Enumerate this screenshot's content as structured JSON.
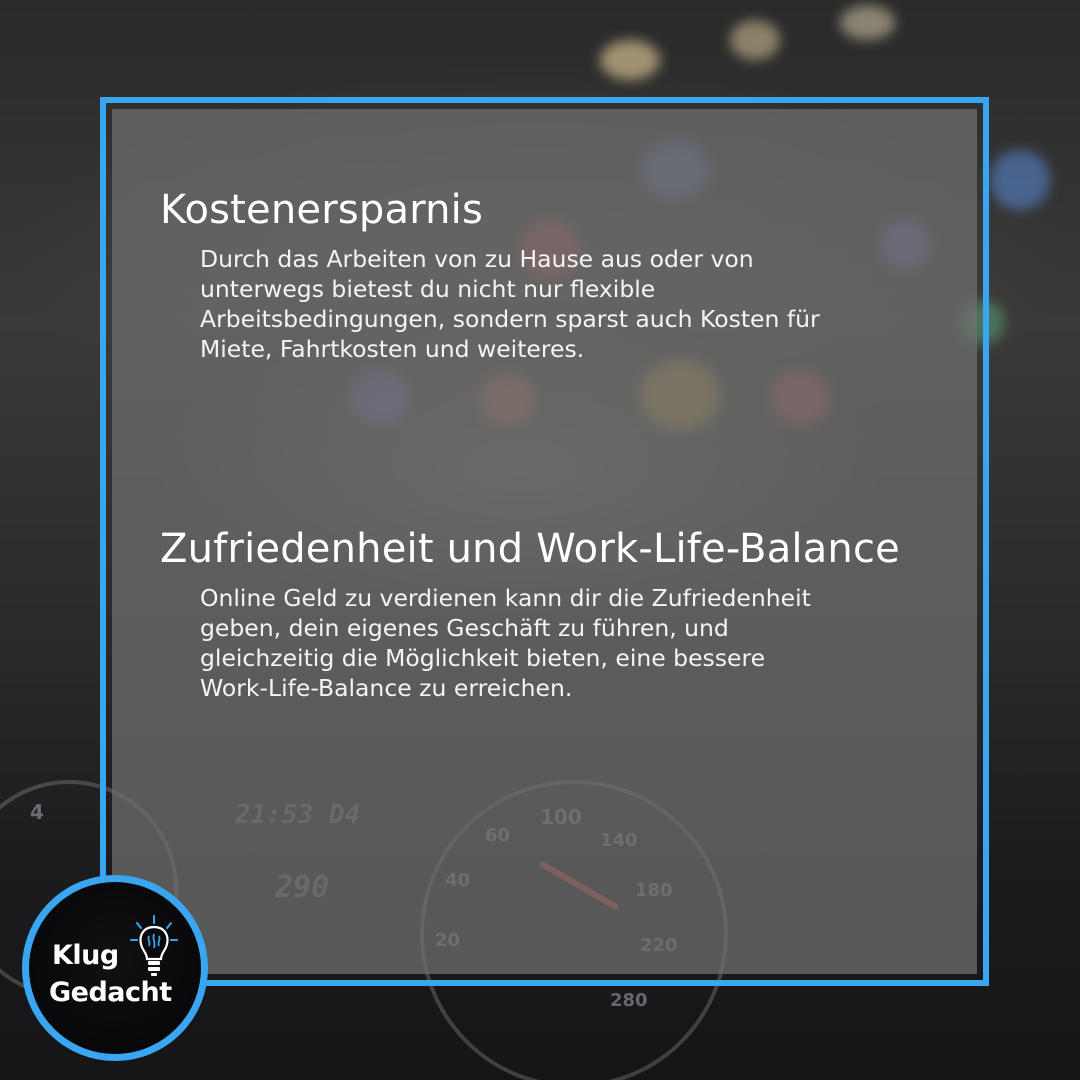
{
  "sections": [
    {
      "title": "Kostenersparnis",
      "body": "Durch das Arbeiten von zu Hause aus oder von unterwegs bietest du nicht nur flexible Arbeitsbedingungen, sondern sparst auch Kosten für Miete, Fahrtkosten und weiteres."
    },
    {
      "title": "Zufriedenheit und Work-Life-Balance",
      "body": "Online Geld zu verdienen kann dir die Zufriedenheit geben, dein eigenes Geschäft zu führen, und gleichzeitig die Möglichkeit bieten, eine bessere Work-Life-Balance zu erreichen."
    }
  ],
  "logo": {
    "line1": "Klug",
    "line2": "Gedacht"
  },
  "colors": {
    "accent": "#3aa6f2",
    "panel": "#707070",
    "text": "#ffffff"
  }
}
